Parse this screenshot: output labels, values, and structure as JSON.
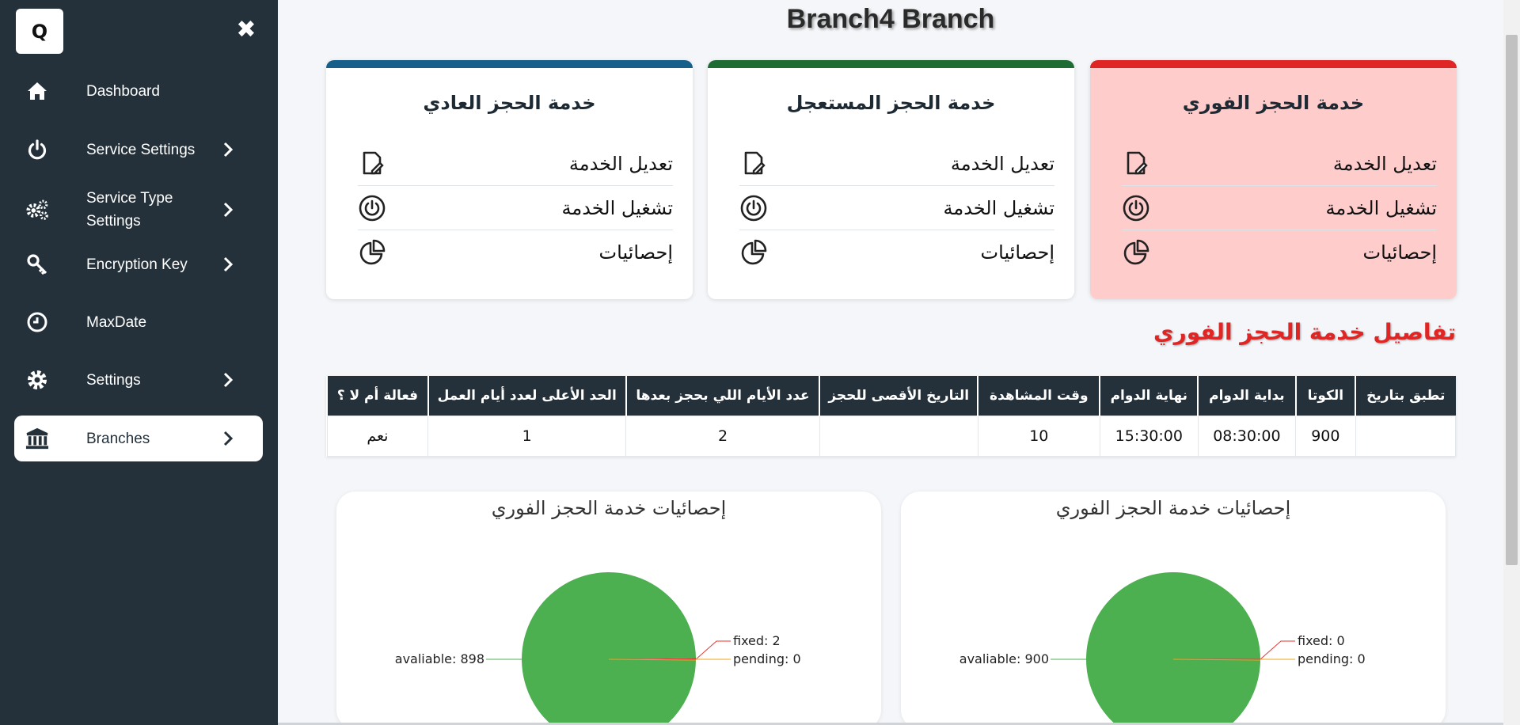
{
  "app": {
    "logo_letter": "Q",
    "close_symbol": "✖"
  },
  "sidebar": {
    "items": [
      {
        "label": "Dashboard",
        "icon": "home-icon",
        "has_chevron": false,
        "active": false
      },
      {
        "label": "Service Settings",
        "icon": "power-icon",
        "has_chevron": true,
        "active": false
      },
      {
        "label": "Service Type Settings",
        "icon": "gears-icon",
        "has_chevron": true,
        "active": false
      },
      {
        "label": "Encryption Key",
        "icon": "key-icon",
        "has_chevron": true,
        "active": false
      },
      {
        "label": "MaxDate",
        "icon": "clock-icon",
        "has_chevron": false,
        "active": false
      },
      {
        "label": "Settings",
        "icon": "gear-icon",
        "has_chevron": true,
        "active": false
      },
      {
        "label": "Branches",
        "icon": "bank-icon",
        "has_chevron": true,
        "active": true
      }
    ]
  },
  "page": {
    "title": "Branch4 Branch"
  },
  "cards": [
    {
      "title": "خدمة الحجز الفوري",
      "accent": "#e02525",
      "background": "#ffcccc",
      "actions": [
        "تعديل الخدمة",
        "تشغيل الخدمة",
        "إحصائيات"
      ]
    },
    {
      "title": "خدمة الحجز المستعجل",
      "accent": "#1e6b33",
      "background": "#ffffff",
      "actions": [
        "تعديل الخدمة",
        "تشغيل الخدمة",
        "إحصائيات"
      ]
    },
    {
      "title": "خدمة الحجز العادي",
      "accent": "#155f8a",
      "background": "#ffffff",
      "actions": [
        "تعديل الخدمة",
        "تشغيل الخدمة",
        "إحصائيات"
      ]
    }
  ],
  "details": {
    "heading": "تفاصيل خدمة الحجز الفوري",
    "columns": [
      "تطبق بتاريخ",
      "الكوتا",
      "بداية الدوام",
      "نهاية الدوام",
      "وقت المشاهدة",
      "التاريخ الأقصى للحجز",
      "عدد الأيام اللي بحجز بعدها",
      "الحد الأعلى لعدد أيام العمل",
      "فعالة أم لا ؟"
    ],
    "rows": [
      [
        "",
        "900",
        "08:30:00",
        "15:30:00",
        "10",
        "",
        "2",
        "1",
        "نعم"
      ]
    ]
  },
  "charts": [
    {
      "title": "إحصائيات خدمة الحجز الفوري",
      "chart_data": {
        "type": "pie",
        "slices": [
          {
            "label": "avaliable",
            "value": 900,
            "color": "#4caf50",
            "line_color": "#4caf50"
          },
          {
            "label": "fixed",
            "value": 0,
            "color": "#e53935",
            "line_color": "#e53935"
          },
          {
            "label": "pending",
            "value": 0,
            "color": "#f2a51a",
            "line_color": "#f2a51a"
          }
        ]
      }
    },
    {
      "title": "إحصائيات خدمة الحجز الفوري",
      "chart_data": {
        "type": "pie",
        "slices": [
          {
            "label": "avaliable",
            "value": 898,
            "color": "#4caf50",
            "line_color": "#4caf50"
          },
          {
            "label": "fixed",
            "value": 2,
            "color": "#e53935",
            "line_color": "#e53935"
          },
          {
            "label": "pending",
            "value": 0,
            "color": "#f2a51a",
            "line_color": "#f2a51a"
          }
        ]
      }
    }
  ]
}
